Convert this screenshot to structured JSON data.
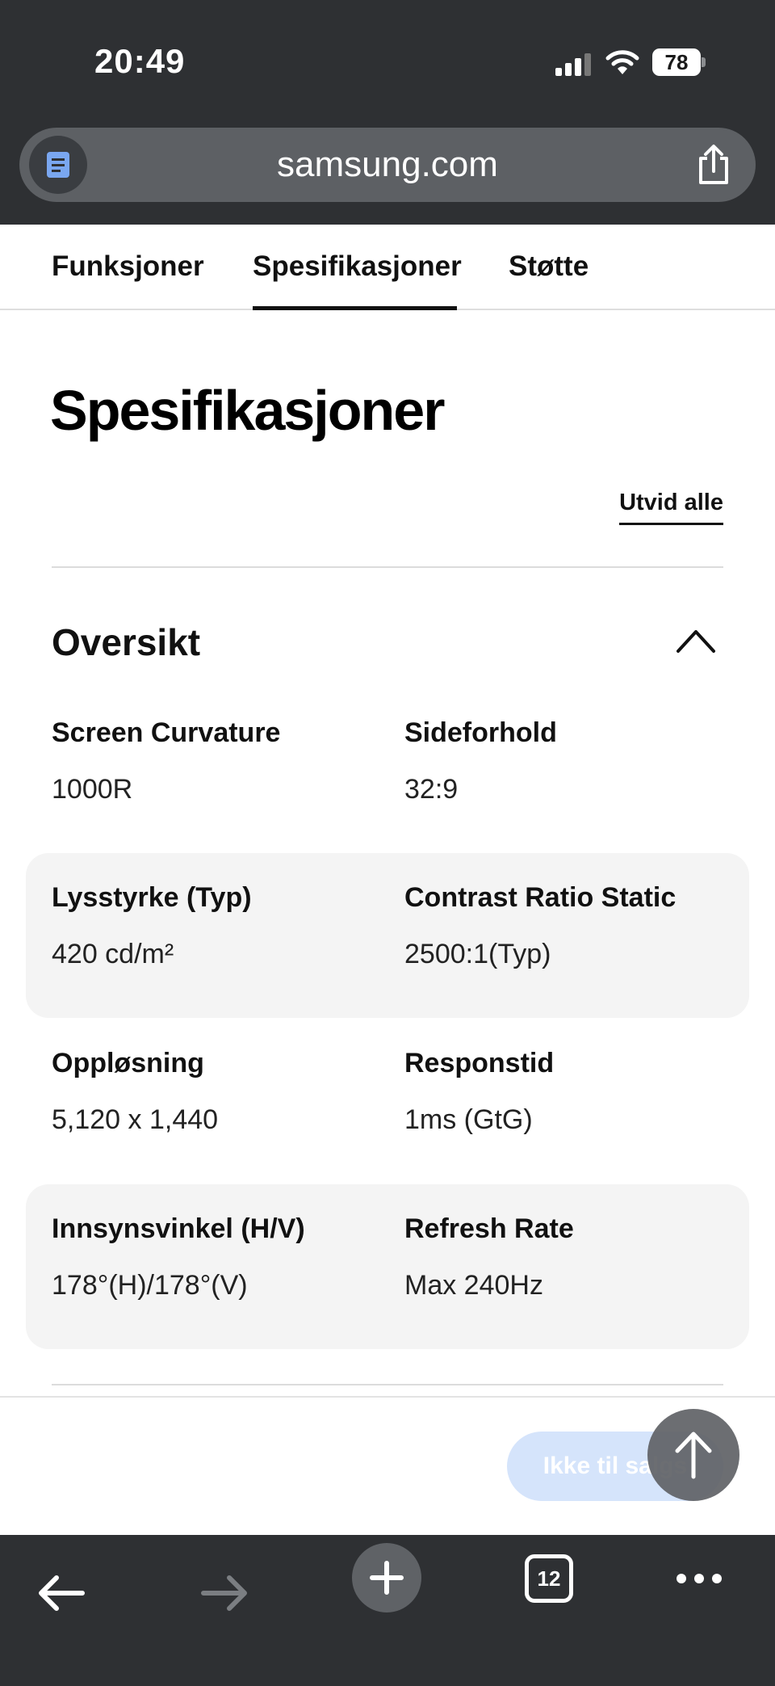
{
  "status_bar": {
    "time": "20:49",
    "battery": "78"
  },
  "browser": {
    "url": "samsung.com",
    "tab_count": "12"
  },
  "subnav": {
    "tabs": [
      {
        "label": "Funksjoner",
        "active": false
      },
      {
        "label": "Spesifikasjoner",
        "active": true
      },
      {
        "label": "Støtte",
        "active": false
      }
    ]
  },
  "page": {
    "title": "Spesifikasjoner",
    "expand_all": "Utvid alle",
    "section_title": "Oversikt"
  },
  "specs": [
    {
      "label": "Screen Curvature",
      "value": "1000R"
    },
    {
      "label": "Sideforhold",
      "value": "32:9"
    },
    {
      "label": "Lysstyrke (Typ)",
      "value": "420 cd/m²"
    },
    {
      "label": "Contrast Ratio Static",
      "value": "2500:1(Typ)"
    },
    {
      "label": "Oppløsning",
      "value": "5,120 x 1,440"
    },
    {
      "label": "Responstid",
      "value": "1ms (GtG)"
    },
    {
      "label": "Innsynsvinkel (H/V)",
      "value": "178°(H)/178°(V)"
    },
    {
      "label": "Refresh Rate",
      "value": "Max 240Hz"
    }
  ],
  "cta": {
    "label": "Ikke til salgs"
  },
  "icons": {
    "reader": "reader-icon",
    "share": "share-icon",
    "collapse": "chevron-up-icon",
    "scroll_top": "arrow-up-icon",
    "back": "arrow-left-icon",
    "forward": "arrow-right-icon",
    "new_tab": "plus-icon",
    "more": "more-icon"
  },
  "colors": {
    "topbar": "#2e3033",
    "cta_disabled": "#d5e4fb",
    "row_shade": "#f4f4f4"
  }
}
